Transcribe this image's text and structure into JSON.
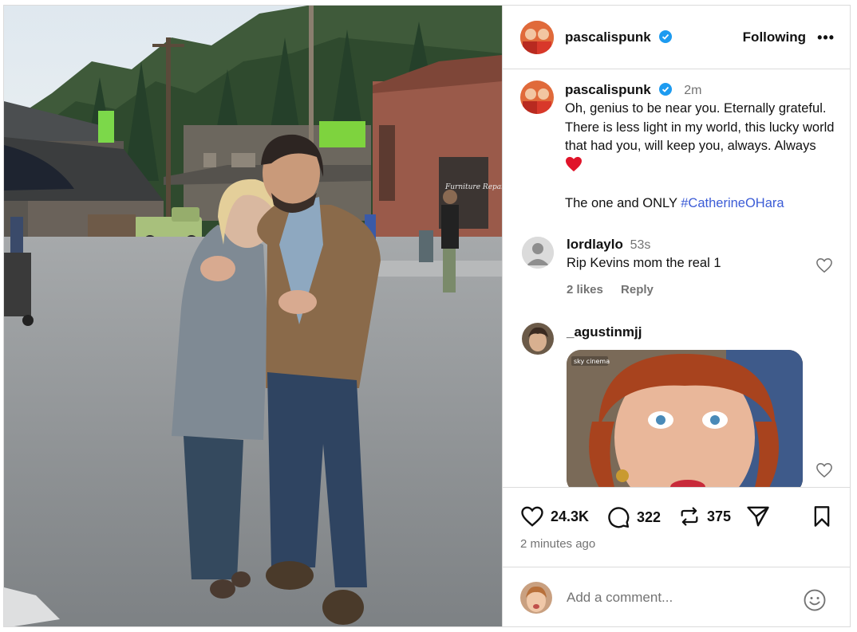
{
  "post": {
    "username": "pascalispunk",
    "follow_state": "Following",
    "more_label": "•••",
    "caption_time": "2m",
    "caption": "Oh, genius to be near you. Eternally grateful.  There is less light in my world, this lucky world that had you, will keep you, always.  Always ",
    "caption_second": "The one and ONLY ",
    "hashtag": "#CatherineOHara",
    "likes": "24.3K",
    "comment_count": "322",
    "reposts": "375",
    "posted_ago": "2 minutes ago"
  },
  "photo": {
    "sign_text": "Furniture Repair"
  },
  "comments": [
    {
      "username": "lordlaylo",
      "time": "53s",
      "text": "Rip Kevins mom the real 1",
      "likes": "2 likes",
      "reply": "Reply"
    },
    {
      "username": "_agustinmjj",
      "gif_label": "sky cinema"
    }
  ],
  "comment_box": {
    "placeholder": "Add a comment..."
  },
  "colors": {
    "accent": "#3c5cd6",
    "verified": "#1d9bf0",
    "heart": "#e0142a"
  }
}
